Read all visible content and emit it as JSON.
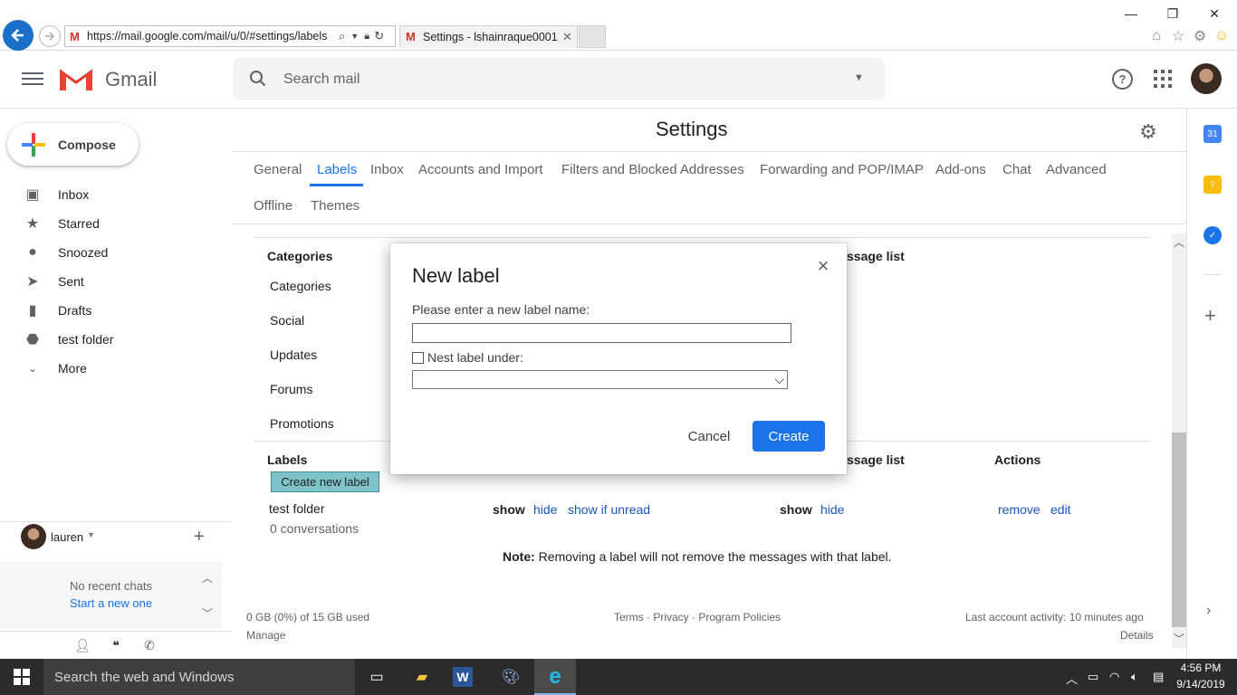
{
  "browser": {
    "url": "https://mail.google.com/mail/u/0/#settings/labels",
    "tab_title": "Settings - lshainraque0001...",
    "minimize": "—",
    "restore": "❐",
    "close": "✕"
  },
  "gmail": {
    "brand": "Gmail",
    "search_placeholder": "Search mail",
    "compose": "Compose",
    "nav": [
      {
        "label": "Inbox",
        "icon": "inbox-icon"
      },
      {
        "label": "Starred",
        "icon": "star-icon"
      },
      {
        "label": "Snoozed",
        "icon": "clock-icon"
      },
      {
        "label": "Sent",
        "icon": "send-icon"
      },
      {
        "label": "Drafts",
        "icon": "draft-icon"
      },
      {
        "label": "test folder",
        "icon": "label-icon"
      },
      {
        "label": "More",
        "icon": "chevron-down-icon"
      }
    ],
    "user": "lauren",
    "no_recent_chats": "No recent chats",
    "start_new": "Start a new one"
  },
  "settings": {
    "title": "Settings",
    "tabs": [
      "General",
      "Labels",
      "Inbox",
      "Accounts and Import",
      "Filters and Blocked Addresses",
      "Forwarding and POP/IMAP",
      "Add-ons",
      "Chat",
      "Advanced",
      "Offline",
      "Themes"
    ],
    "active_tab": "Labels",
    "categories_header": "Categories",
    "message_list_header_partial": "ssage list",
    "categories": [
      "Categories",
      "Social",
      "Updates",
      "Forums",
      "Promotions"
    ],
    "labels_header": "Labels",
    "actions_header": "Actions",
    "create_new_label": "Create new label",
    "label_row": {
      "name": "test folder",
      "conversations": "0 conversations",
      "show": "show",
      "hide": "hide",
      "show_if_unread": "show if unread",
      "show2": "show",
      "hide2": "hide",
      "remove": "remove",
      "edit": "edit"
    },
    "note_bold": "Note:",
    "note_text": " Removing a label will not remove the messages with that label."
  },
  "footer": {
    "storage": "0 GB (0%) of 15 GB used",
    "manage": "Manage",
    "links": "Terms · Privacy · Program Policies",
    "activity": "Last account activity: 10 minutes ago",
    "details": "Details"
  },
  "modal": {
    "title": "New label",
    "prompt": "Please enter a new label name:",
    "input_value": "",
    "nest_label": "Nest label under:",
    "nest_selected": "",
    "cancel": "Cancel",
    "create": "Create"
  },
  "taskbar": {
    "search_placeholder": "Search the web and Windows",
    "time": "4:56 PM",
    "date": "9/14/2019"
  },
  "colors": {
    "accent": "#1a73e8",
    "gmail_red": "#ea4335",
    "taskbar": "#2b2b2b"
  }
}
